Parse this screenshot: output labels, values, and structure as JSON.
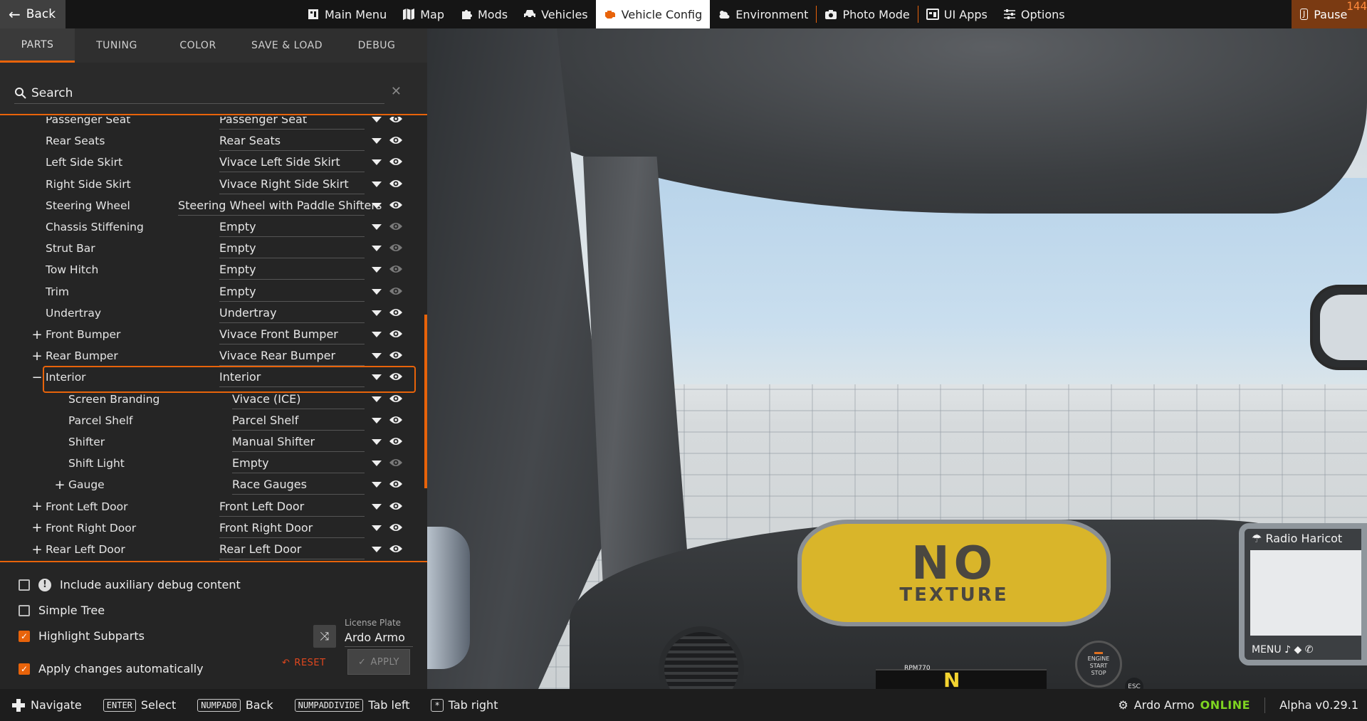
{
  "topbar": {
    "back_label": "Back",
    "nav": [
      {
        "label": "Main Menu",
        "icon": "main-menu-icon"
      },
      {
        "label": "Map",
        "icon": "map-icon"
      },
      {
        "label": "Mods",
        "icon": "puzzle-icon"
      },
      {
        "label": "Vehicles",
        "icon": "car-icon"
      },
      {
        "label": "Vehicle Config",
        "icon": "engine-icon",
        "active": true
      },
      {
        "label": "Environment",
        "icon": "weather-icon"
      },
      {
        "label": "Photo Mode",
        "icon": "camera-icon"
      },
      {
        "label": "UI Apps",
        "icon": "apps-icon"
      },
      {
        "label": "Options",
        "icon": "sliders-icon"
      }
    ],
    "pause_key": "J",
    "pause_label": "Pause",
    "fps": "144"
  },
  "panel": {
    "tabs": [
      "PARTS",
      "TUNING",
      "COLOR",
      "SAVE & LOAD",
      "DEBUG"
    ],
    "active_tab": "PARTS",
    "search_placeholder": "Search",
    "parts": [
      {
        "name": "Passenger Seat",
        "value": "Passenger Seat",
        "level": 0,
        "expander": "",
        "visible": true
      },
      {
        "name": "Rear Seats",
        "value": "Rear Seats",
        "level": 0,
        "expander": "",
        "visible": true
      },
      {
        "name": "Left Side Skirt",
        "value": "Vivace Left Side Skirt",
        "level": 0,
        "expander": "",
        "visible": true
      },
      {
        "name": "Right Side Skirt",
        "value": "Vivace Right Side Skirt",
        "level": 0,
        "expander": "",
        "visible": true
      },
      {
        "name": "Steering Wheel",
        "value": "Steering Wheel with Paddle Shifters",
        "level": 0,
        "expander": "",
        "visible": true
      },
      {
        "name": "Chassis Stiffening",
        "value": "Empty",
        "level": 0,
        "expander": "",
        "visible": false
      },
      {
        "name": "Strut Bar",
        "value": "Empty",
        "level": 0,
        "expander": "",
        "visible": false
      },
      {
        "name": "Tow Hitch",
        "value": "Empty",
        "level": 0,
        "expander": "",
        "visible": false
      },
      {
        "name": "Trim",
        "value": "Empty",
        "level": 0,
        "expander": "",
        "visible": false
      },
      {
        "name": "Undertray",
        "value": "Undertray",
        "level": 0,
        "expander": "",
        "visible": true
      },
      {
        "name": "Front Bumper",
        "value": "Vivace Front Bumper",
        "level": 0,
        "expander": "+",
        "visible": true
      },
      {
        "name": "Rear Bumper",
        "value": "Vivace Rear Bumper",
        "level": 0,
        "expander": "+",
        "visible": true
      },
      {
        "name": "Interior",
        "value": "Interior",
        "level": 0,
        "expander": "−",
        "visible": true,
        "selected": true
      },
      {
        "name": "Screen Branding",
        "value": "Vivace (ICE)",
        "level": 1,
        "expander": "",
        "visible": true
      },
      {
        "name": "Parcel Shelf",
        "value": "Parcel Shelf",
        "level": 1,
        "expander": "",
        "visible": true
      },
      {
        "name": "Shifter",
        "value": "Manual Shifter",
        "level": 1,
        "expander": "",
        "visible": true
      },
      {
        "name": "Shift Light",
        "value": "Empty",
        "level": 1,
        "expander": "",
        "visible": false
      },
      {
        "name": "Gauge",
        "value": "Race Gauges",
        "level": 1,
        "expander": "+",
        "visible": true
      },
      {
        "name": "Front Left Door",
        "value": "Front Left Door",
        "level": 0,
        "expander": "+",
        "visible": true
      },
      {
        "name": "Front Right Door",
        "value": "Front Right Door",
        "level": 0,
        "expander": "+",
        "visible": true
      },
      {
        "name": "Rear Left Door",
        "value": "Rear Left Door",
        "level": 0,
        "expander": "+",
        "visible": true
      }
    ],
    "options": {
      "aux_debug": {
        "label": "Include auxiliary debug content",
        "checked": false
      },
      "simple_tree": {
        "label": "Simple Tree",
        "checked": false
      },
      "highlight_subparts": {
        "label": "Highlight Subparts",
        "checked": true
      },
      "apply_auto": {
        "label": "Apply changes automatically",
        "checked": true
      }
    },
    "license_plate_label": "License Plate",
    "license_plate_value": "Ardo Armo",
    "reset_label": "RESET",
    "apply_label": "APPLY"
  },
  "viewport": {
    "badge_big": "NO",
    "badge_small": "TEXTURE",
    "radio_title": "Radio Haricot",
    "radio_menu": "MENU",
    "start_stop": [
      "ENGINE",
      "START",
      "STOP"
    ],
    "esc_label": "ESC",
    "gear": "N",
    "rpm": "RPM770"
  },
  "bottombar": {
    "hints": [
      {
        "key": "",
        "icon": "dpad-icon",
        "label": "Navigate"
      },
      {
        "key": "ENTER",
        "label": "Select"
      },
      {
        "key": "NUMPAD0",
        "label": "Back"
      },
      {
        "key": "NUMPADDIVIDE",
        "label": "Tab left"
      },
      {
        "key": "*",
        "label": "Tab right"
      }
    ],
    "user": "Ardo Armo",
    "status": "ONLINE",
    "version": "Alpha v0.29.1"
  },
  "colors": {
    "accent": "#e8630a",
    "online": "#7ed321",
    "reset": "#e0471e"
  }
}
